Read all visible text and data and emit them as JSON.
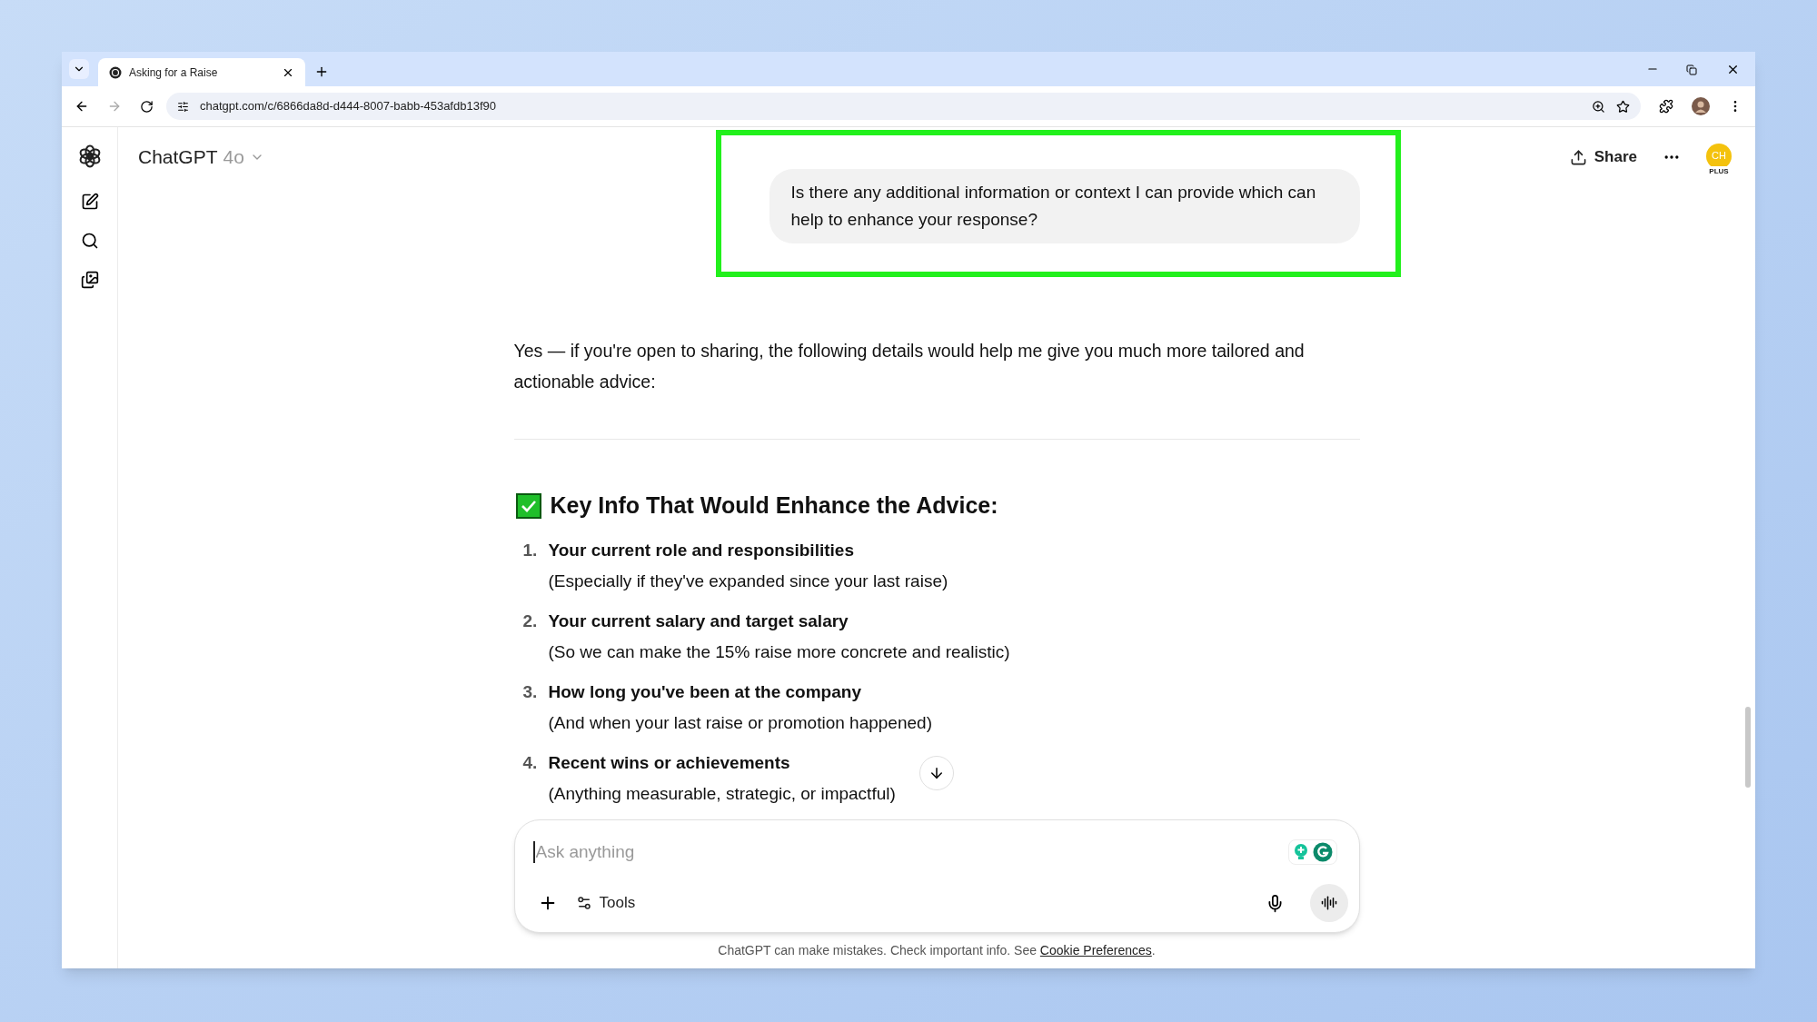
{
  "browser": {
    "tabs": [
      {
        "title": "Asking for a Raise",
        "selected": true
      }
    ],
    "url": "chatgpt.com/c/6866da8d-d444-8007-babb-453afdb13f90"
  },
  "header": {
    "app_name": "ChatGPT",
    "model": "4o",
    "share": "Share",
    "avatar_initials": "CH",
    "plan_badge": "PLUS"
  },
  "user_message": "Is there any additional information or context I can provide which can help to enhance your response?",
  "response": {
    "intro": "Yes — if you're open to sharing, the following details would help me give you much more tailored and actionable advice:",
    "heading": "Key Info That Would Enhance the Advice:",
    "items": [
      {
        "number": "1.",
        "title": "Your current role and responsibilities",
        "detail": "(Especially if they've expanded since your last raise)"
      },
      {
        "number": "2.",
        "title": "Your current salary and target salary",
        "detail": "(So we can make the 15% raise more concrete and realistic)"
      },
      {
        "number": "3.",
        "title": "How long you've been at the company",
        "detail": "(And when your last raise or promotion happened)"
      },
      {
        "number": "4.",
        "title": "Recent wins or achievements",
        "detail": "(Anything measurable, strategic, or impactful)"
      }
    ]
  },
  "composer": {
    "placeholder": "Ask anything",
    "tools": "Tools"
  },
  "footer": {
    "text": "ChatGPT can make mistakes. Check important info. See ",
    "link": "Cookie Preferences",
    "after": "."
  }
}
